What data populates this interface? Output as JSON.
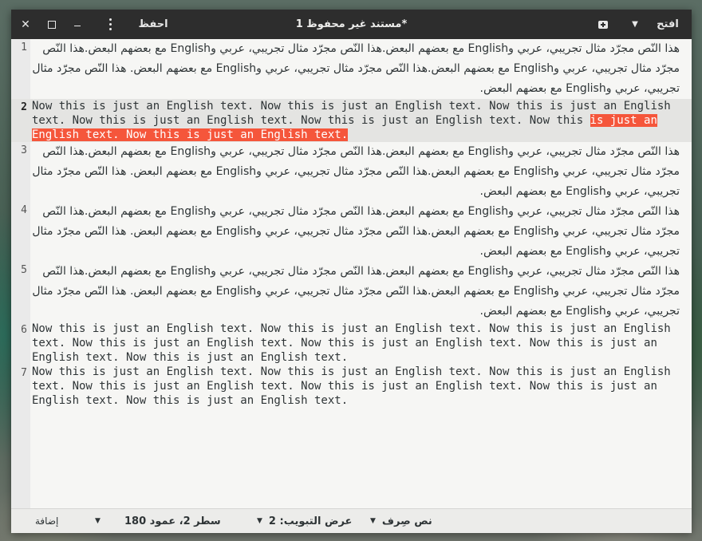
{
  "window": {
    "title": "*مستند غير محفوظ 1",
    "save_label": "احفظ",
    "open_label": "افتح",
    "close_glyph": "✕"
  },
  "editor": {
    "lines": [
      {
        "num": "1",
        "kind": "ar",
        "text": "هذا النّص مجرّد مثال تجريبي، عربي وEnglish مع بعضهم البعض.هذا النّص مجرّد مثال تجريبي، عربي وEnglish مع بعضهم البعض.هذا النّص مجرّد مثال تجريبي، عربي وEnglish مع بعضهم البعض.هذا النّص مجرّد مثال تجريبي، عربي وEnglish مع بعضهم البعض. هذا النّص مجرّد مثال تجريبي، عربي وEnglish مع بعضهم البعض."
      },
      {
        "num": "2",
        "kind": "en",
        "current": true,
        "text": "Now this is just an English text. Now this is just an English text. Now this is just an English text. Now this is just an English text. Now this is just an English text. Now this ",
        "selected": "is just an English text. Now this is just an English text."
      },
      {
        "num": "3",
        "kind": "ar",
        "text": "هذا النّص مجرّد مثال تجريبي، عربي وEnglish مع بعضهم البعض.هذا النّص مجرّد مثال تجريبي، عربي وEnglish مع بعضهم البعض.هذا النّص مجرّد مثال تجريبي، عربي وEnglish مع بعضهم البعض.هذا النّص مجرّد مثال تجريبي، عربي وEnglish مع بعضهم البعض. هذا النّص مجرّد مثال تجريبي، عربي وEnglish مع بعضهم البعض."
      },
      {
        "num": "4",
        "kind": "ar",
        "text": "هذا النّص مجرّد مثال تجريبي، عربي وEnglish مع بعضهم البعض.هذا النّص مجرّد مثال تجريبي، عربي وEnglish مع بعضهم البعض.هذا النّص مجرّد مثال تجريبي، عربي وEnglish مع بعضهم البعض.هذا النّص مجرّد مثال تجريبي، عربي وEnglish مع بعضهم البعض. هذا النّص مجرّد مثال تجريبي، عربي وEnglish مع بعضهم البعض."
      },
      {
        "num": "5",
        "kind": "ar",
        "text": "هذا النّص مجرّد مثال تجريبي، عربي وEnglish مع بعضهم البعض.هذا النّص مجرّد مثال تجريبي، عربي وEnglish مع بعضهم البعض.هذا النّص مجرّد مثال تجريبي، عربي وEnglish مع بعضهم البعض.هذا النّص مجرّد مثال تجريبي، عربي وEnglish مع بعضهم البعض. هذا النّص مجرّد مثال تجريبي، عربي وEnglish مع بعضهم البعض."
      },
      {
        "num": "6",
        "kind": "en",
        "text": "Now this is just an English text. Now this is just an English text. Now this is just an English text. Now this is just an English text. Now this is just an English text. Now this is just an English text. Now this is just an English text."
      },
      {
        "num": "7",
        "kind": "en",
        "text": "Now this is just an English text. Now this is just an English text. Now this is just an English text. Now this is just an English text. Now this is just an English text. Now this is just an English text. Now this is just an English text."
      }
    ],
    "selection_color": "#f5563b"
  },
  "statusbar": {
    "addon_label": "إضافة",
    "position": "سطر 2، عمود 180",
    "tab_width": "عرض التبويب: 2",
    "syntax": "نص صِرف"
  }
}
